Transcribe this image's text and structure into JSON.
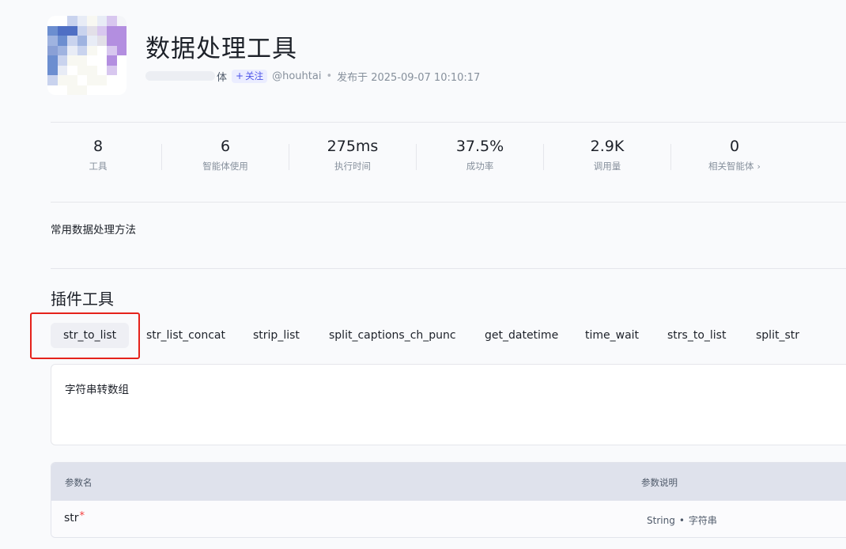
{
  "header": {
    "title": "数据处理工具",
    "author_suffix": "体",
    "follow_label": "关注",
    "handle": "@houhtai",
    "separator": "•",
    "published_label": "发布于 2025-09-07 10:10:17"
  },
  "stats": [
    {
      "value": "8",
      "label": "工具"
    },
    {
      "value": "6",
      "label": "智能体使用"
    },
    {
      "value": "275ms",
      "label": "执行时间"
    },
    {
      "value": "37.5%",
      "label": "成功率"
    },
    {
      "value": "2.9K",
      "label": "调用量"
    },
    {
      "value": "0",
      "label": "相关智能体"
    }
  ],
  "description": "常用数据处理方法",
  "tools_section": {
    "title": "插件工具",
    "tabs": [
      "str_to_list",
      "str_list_concat",
      "strip_list",
      "split_captions_ch_punc",
      "get_datetime",
      "time_wait",
      "strs_to_list",
      "split_str"
    ],
    "active_tab": "str_to_list",
    "tool_description": "字符串转数组"
  },
  "params_table": {
    "headers": {
      "name": "参数名",
      "description": "参数说明"
    },
    "rows": [
      {
        "name": "str",
        "required_mark": "*",
        "type": "String",
        "dot": "•",
        "desc": "字符串"
      }
    ]
  },
  "colors": {
    "accent": "#4c54e8",
    "highlight_border": "#e5221b",
    "required": "#f53f3f"
  }
}
